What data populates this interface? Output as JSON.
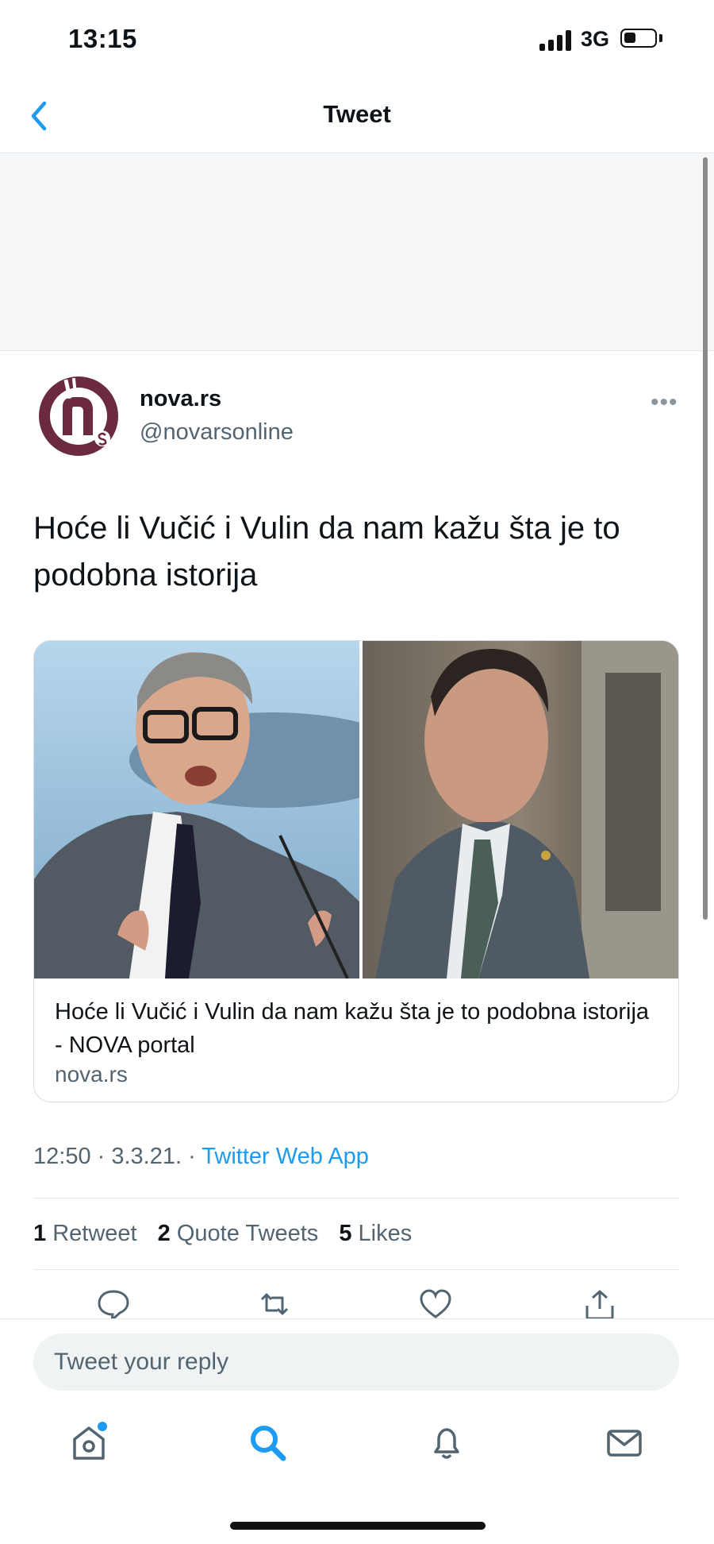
{
  "status_bar": {
    "time": "13:15",
    "network": "3G"
  },
  "nav": {
    "title": "Tweet",
    "back_icon": "chevron-left-icon"
  },
  "tweet": {
    "author_name": "nova.rs",
    "author_handle": "@novarsonline",
    "more_label": "•••",
    "text": "Hoće li Vučić i Vulin da nam kažu šta je to podobna istorija",
    "card": {
      "title": "Hoće li Vučić i Vulin da nam kažu šta je to podobna istorija - NOVA portal",
      "domain": "nova.rs"
    },
    "time": "12:50",
    "separator": " · ",
    "date": "3.3.21.",
    "source": "Twitter Web App",
    "stats": {
      "retweets_count": "1",
      "retweets_label": "Retweet",
      "quotes_count": "2",
      "quotes_label": "Quote Tweets",
      "likes_count": "5",
      "likes_label": "Likes"
    }
  },
  "reply": {
    "placeholder": "Tweet your reply"
  },
  "tab_bar": [
    "home-icon",
    "search-icon",
    "notifications-icon",
    "messages-icon"
  ],
  "colors": {
    "accent": "#1d9bf0",
    "brand_avatar": "#6b2a40",
    "text": "#0f1419",
    "secondary_text": "#536471"
  }
}
